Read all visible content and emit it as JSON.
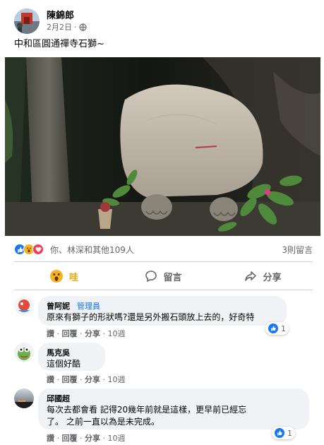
{
  "post": {
    "author": "陳錦郎",
    "date": "2月2日",
    "meta_separator": "·",
    "privacy_icon": "globe-icon",
    "text": "中和區圓通禪寺石獅~"
  },
  "stats": {
    "reaction_icons": [
      "like-icon",
      "wow-icon",
      "love-icon"
    ],
    "reaction_summary": "你、林深和其他109人",
    "comment_count": "3則留言"
  },
  "actions": {
    "wow_label": "哇",
    "comment_label": "留言",
    "share_label": "分享"
  },
  "comments": [
    {
      "name": "曾阿妮",
      "badge": "管理員",
      "text": "原來有獅子的形狀嗎?還是另外搬石頭放上去的，好奇特",
      "like_label": "讚",
      "reply_label": "回覆",
      "share_label": "分享",
      "time": "10週",
      "like_count": "1"
    },
    {
      "name": "馬克吳",
      "text": "這個好酷",
      "like_label": "讚",
      "reply_label": "回覆",
      "share_label": "分享",
      "time": "10週"
    },
    {
      "name": "邱國超",
      "text_line1": "每次去都會看 記得20幾年前就是這樣，更早前已經忘",
      "text_line2": "了。 之前一直以為是未完成。",
      "like_label": "讚",
      "reply_label": "回覆",
      "share_label": "分享",
      "time": "10週",
      "like_count": "1"
    }
  ],
  "separator": "·",
  "colors": {
    "accent_blue": "#1877f2",
    "wow_yellow": "#f7b125",
    "love_red": "#f33e58",
    "secondary_text": "#65676b",
    "bubble_bg": "#f0f2f5"
  }
}
